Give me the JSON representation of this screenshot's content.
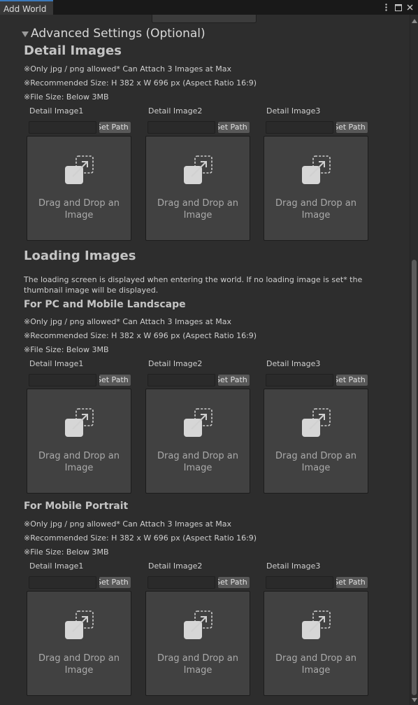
{
  "window": {
    "tab_title": "Add World",
    "menu_icon": "kebab-menu-icon",
    "maximize_icon": "maximize-icon",
    "close_icon": "close-icon"
  },
  "advanced": {
    "foldout_label": "Advanced Settings (Optional)",
    "expanded": true
  },
  "detail_section": {
    "title": "Detail Images",
    "notes": [
      "※Only jpg / png allowed* Can Attach 3 Images at Max",
      "※Recommended Size: H 382 x W 696 px (Aspect Ratio 16:9)",
      "※File Size: Below 3MB"
    ],
    "slots": [
      {
        "label": "Detail Image1",
        "path": "",
        "button": "Set Path",
        "drop_text": "Drag and Drop an Image"
      },
      {
        "label": "Detail Image2",
        "path": "",
        "button": "Set Path",
        "drop_text": "Drag and Drop an Image"
      },
      {
        "label": "Detail Image3",
        "path": "",
        "button": "Set Path",
        "drop_text": "Drag and Drop an Image"
      }
    ]
  },
  "loading_section": {
    "title": "Loading Images",
    "description": "The loading screen is displayed when entering the world. If no loading image is set* the thumbnail image will be displayed.",
    "landscape": {
      "title": "For PC and Mobile Landscape",
      "notes": [
        "※Only jpg / png allowed* Can Attach 3 Images at Max",
        "※Recommended Size: H 382 x W 696 px (Aspect Ratio 16:9)",
        "※File Size: Below 3MB"
      ],
      "slots": [
        {
          "label": "Detail Image1",
          "path": "",
          "button": "Set Path",
          "drop_text": "Drag and Drop an Image"
        },
        {
          "label": "Detail Image2",
          "path": "",
          "button": "Set Path",
          "drop_text": "Drag and Drop an Image"
        },
        {
          "label": "Detail Image3",
          "path": "",
          "button": "Set Path",
          "drop_text": "Drag and Drop an Image"
        }
      ]
    },
    "portrait": {
      "title": "For Mobile Portrait",
      "notes": [
        "※Only jpg / png allowed* Can Attach 3 Images at Max",
        "※Recommended Size: H 382 x W 696 px (Aspect Ratio 16:9)",
        "※File Size: Below 3MB"
      ],
      "slots": [
        {
          "label": "Detail Image1",
          "path": "",
          "button": "Set Path",
          "drop_text": "Drag and Drop an Image"
        },
        {
          "label": "Detail Image2",
          "path": "",
          "button": "Set Path",
          "drop_text": "Drag and Drop an Image"
        },
        {
          "label": "Detail Image3",
          "path": "",
          "button": "Set Path",
          "drop_text": "Drag and Drop an Image"
        }
      ]
    }
  }
}
